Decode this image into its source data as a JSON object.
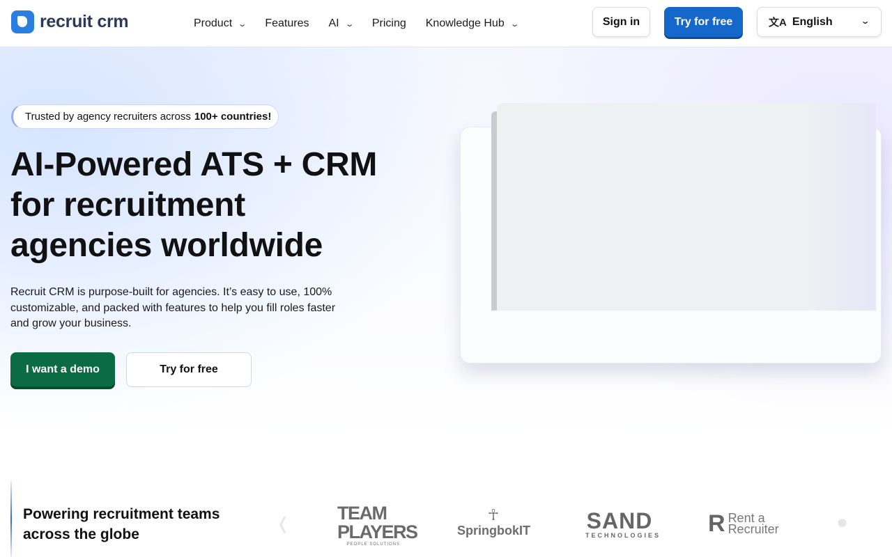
{
  "header": {
    "logo_text": "recruit crm",
    "nav": [
      {
        "label": "Product",
        "has_dropdown": true
      },
      {
        "label": "Features",
        "has_dropdown": false
      },
      {
        "label": "AI",
        "has_dropdown": true
      },
      {
        "label": "Pricing",
        "has_dropdown": false
      },
      {
        "label": "Knowledge Hub",
        "has_dropdown": true
      }
    ],
    "sign_in": "Sign in",
    "try_free": "Try for free",
    "language": "English"
  },
  "hero": {
    "trusted_prefix": "Trusted by agency recruiters across",
    "trusted_bold": "100+ countries!",
    "headline": "AI-Powered ATS + CRM for recruitment agencies worldwide",
    "subtext": "Recruit CRM is purpose-built for agencies. It’s easy to use, 100% customizable, and packed with features to help you fill roles faster and grow your business.",
    "demo_button": "I want a demo",
    "try_button": "Try for free"
  },
  "partners": {
    "title": "Powering recruitment teams across the globe",
    "logos": [
      {
        "name": "TEAM PLAYERS",
        "tagline": "PEOPLE SOLUTIONS"
      },
      {
        "name": "SpringbokIT"
      },
      {
        "name": "SAND",
        "tagline": "TECHNOLOGIES"
      },
      {
        "name": "Rent a Recruiter"
      }
    ]
  },
  "colors": {
    "brand_blue": "#1567c9",
    "demo_green": "#0b6b44",
    "logo_blue": "#2a7ee0"
  }
}
